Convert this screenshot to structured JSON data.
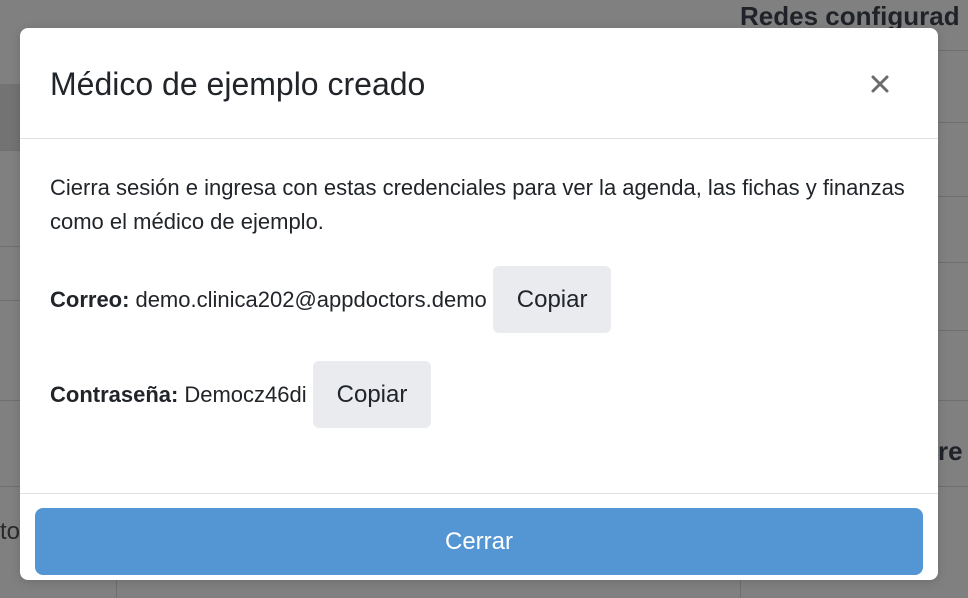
{
  "background": {
    "page_heading": "Redes configurad",
    "side_text": "re",
    "left_text": "to"
  },
  "modal": {
    "title": "Médico de ejemplo creado",
    "close_icon": "close-icon",
    "intro_text": "Cierra sesión e ingresa con estas credenciales para ver la agenda, las fichas y finanzas como el médico de ejemplo.",
    "credentials": {
      "email_label": "Correo:",
      "email_value": "demo.clinica202@appdoctors.demo",
      "password_label": "Contraseña:",
      "password_value": "Democz46di",
      "copy_label": "Copiar"
    },
    "close_button_label": "Cerrar"
  },
  "colors": {
    "primary": "#5495d3",
    "copy_button_bg": "#e9ebef",
    "backdrop": "#808080"
  }
}
